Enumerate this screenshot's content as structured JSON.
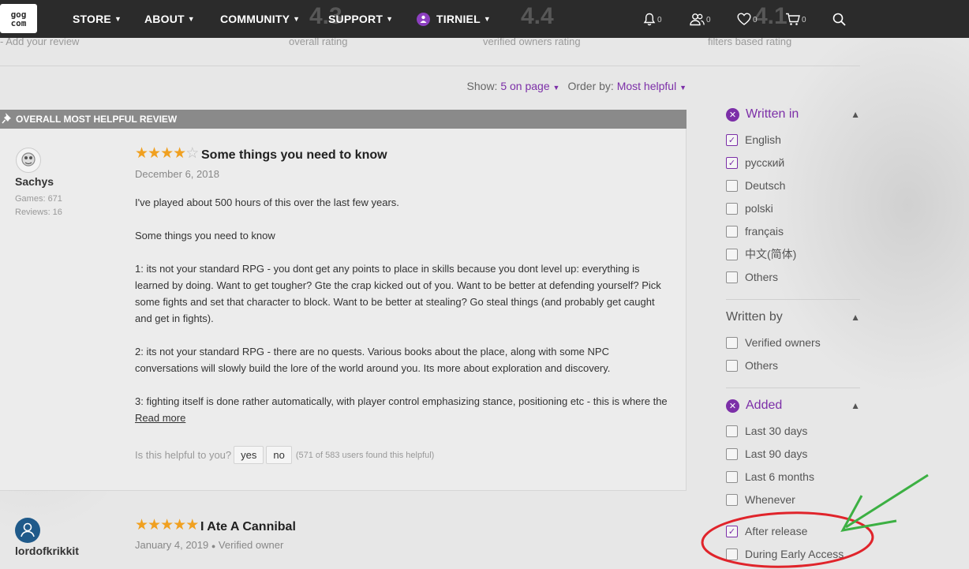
{
  "header": {
    "logo_line1": "gog",
    "logo_line2": "com",
    "nav": [
      {
        "label": "STORE"
      },
      {
        "label": "ABOUT"
      },
      {
        "label": "COMMUNITY"
      },
      {
        "label": "SUPPORT"
      }
    ],
    "user": "TIRNIEL",
    "notifications_count": "0",
    "friends_count": "0",
    "wishlist_count": "0",
    "cart_count": "0"
  },
  "summary": {
    "add_review": "Add your review",
    "overall_value": "4.3",
    "overall_label": "overall rating",
    "owners_value": "4.4",
    "owners_label": "verified owners rating",
    "filtered_value": "4.1",
    "filtered_label": "filters based rating"
  },
  "toolbar": {
    "show_label": "Show:",
    "show_value": "5 on page",
    "order_label": "Order by:",
    "order_value": "Most helpful"
  },
  "pinned": {
    "label": "OVERALL MOST HELPFUL REVIEW"
  },
  "review1": {
    "author": "Sachys",
    "games": "Games: 671",
    "reviews": "Reviews: 16",
    "rating": 4,
    "title": "Some things you need to know",
    "date": "December 6, 2018",
    "p1": "I've played about 500 hours of this over the last few years.",
    "p2": "Some things you need to know",
    "p3": "1: its not your standard RPG - you dont get any points to place in skills because you dont level up: everything is learned by doing. Want to get tougher? Gte the crap kicked out of you. Want to be better at defending yourself? Pick some fights and set that character to block. Want to be better at stealing? Go steal things (and probably get caught and get in fights).",
    "p4": "2: its not your standard RPG - there are no quests. Various books about the place, along with some NPC conversations will slowly build the lore of the world around you. Its more about exploration and discovery.",
    "p5": "3: fighting itself is done rather automatically, with player control emphasizing stance, positioning etc - this is where the",
    "read_more": "Read more",
    "helpful_q": "Is this helpful to you?",
    "yes": "yes",
    "no": "no",
    "helpful_count": "(571 of 583 users found this helpful)"
  },
  "review2": {
    "author": "lordofkrikkit",
    "rating": 5,
    "title": "I Ate A Cannibal",
    "date": "January 4, 2019",
    "verified": "Verified owner"
  },
  "filters": {
    "written_in": {
      "title": "Written in",
      "items": [
        {
          "label": "English",
          "checked": true
        },
        {
          "label": "русский",
          "checked": true
        },
        {
          "label": "Deutsch",
          "checked": false
        },
        {
          "label": "polski",
          "checked": false
        },
        {
          "label": "français",
          "checked": false
        },
        {
          "label": "中文(简体)",
          "checked": false
        },
        {
          "label": "Others",
          "checked": false
        }
      ]
    },
    "written_by": {
      "title": "Written by",
      "items": [
        {
          "label": "Verified owners",
          "checked": false
        },
        {
          "label": "Others",
          "checked": false
        }
      ]
    },
    "added": {
      "title": "Added",
      "items": [
        {
          "label": "Last 30 days",
          "checked": false
        },
        {
          "label": "Last 90 days",
          "checked": false
        },
        {
          "label": "Last 6 months",
          "checked": false
        },
        {
          "label": "Whenever",
          "checked": false
        },
        {
          "label": "After release",
          "checked": true
        },
        {
          "label": "During Early Access",
          "checked": false
        }
      ]
    }
  },
  "colors": {
    "accent": "#7c2fa8",
    "star": "#f0a020",
    "annotation_circle": "#e0242b",
    "annotation_arrow": "#3cb043"
  }
}
